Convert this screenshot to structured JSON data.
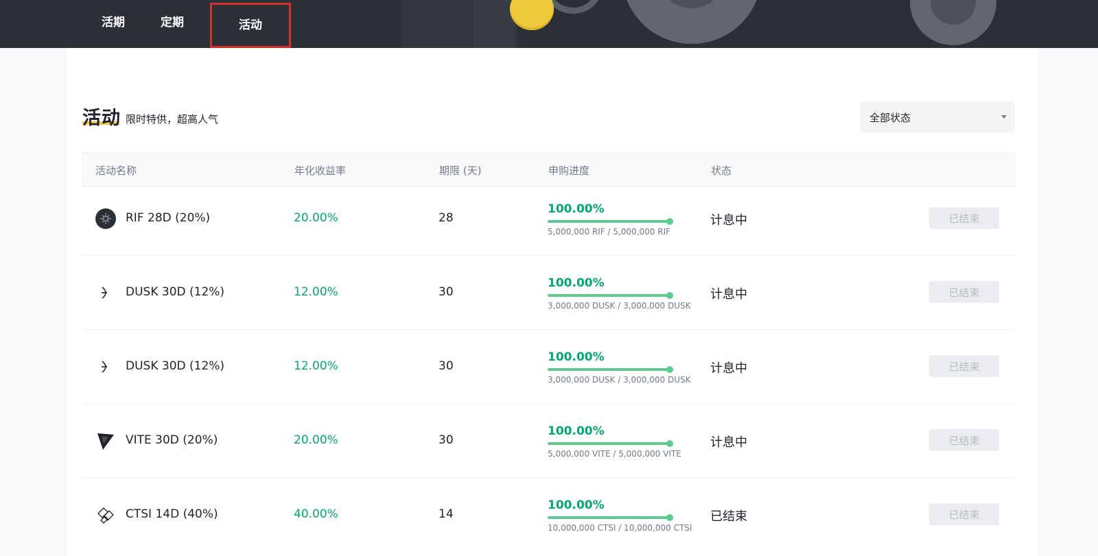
{
  "nav": {
    "tabs": [
      {
        "label": "活期"
      },
      {
        "label": "定期"
      },
      {
        "label": "活动"
      }
    ],
    "active_tab": "活动"
  },
  "section": {
    "title": "活动",
    "subtitle": "限时特供，超高人气"
  },
  "filter": {
    "selected": "全部状态"
  },
  "table": {
    "headers": {
      "name": "活动名称",
      "apy": "年化收益率",
      "term": "期限 (天)",
      "progress": "申购进度",
      "status": "状态"
    },
    "rows": [
      {
        "icon": "rif-icon",
        "name": "RIF 28D (20%)",
        "apy": "20.00%",
        "term": "28",
        "progress_pct": "100.00%",
        "progress_fraction": 1.0,
        "amount": "5,000,000 RIF / 5,000,000 RIF",
        "status": "计息中",
        "button": "已结束"
      },
      {
        "icon": "dusk-icon",
        "name": "DUSK 30D (12%)",
        "apy": "12.00%",
        "term": "30",
        "progress_pct": "100.00%",
        "progress_fraction": 1.0,
        "amount": "3,000,000 DUSK / 3,000,000 DUSK",
        "status": "计息中",
        "button": "已结束"
      },
      {
        "icon": "dusk-icon",
        "name": "DUSK 30D (12%)",
        "apy": "12.00%",
        "term": "30",
        "progress_pct": "100.00%",
        "progress_fraction": 1.0,
        "amount": "3,000,000 DUSK / 3,000,000 DUSK",
        "status": "计息中",
        "button": "已结束"
      },
      {
        "icon": "vite-icon",
        "name": "VITE 30D (20%)",
        "apy": "20.00%",
        "term": "30",
        "progress_pct": "100.00%",
        "progress_fraction": 1.0,
        "amount": "5,000,000 VITE / 5,000,000 VITE",
        "status": "计息中",
        "button": "已结束"
      },
      {
        "icon": "ctsi-icon",
        "name": "CTSI 14D (40%)",
        "apy": "40.00%",
        "term": "14",
        "progress_pct": "100.00%",
        "progress_fraction": 1.0,
        "amount": "10,000,000 CTSI / 10,000,000 CTSI",
        "status": "已结束",
        "button": "已结束"
      }
    ]
  },
  "colors": {
    "header_bg": "#2b2f36",
    "accent_green": "#03a66d",
    "progress_green": "#5fcb8e",
    "highlight_red": "#d0322b",
    "title_underline": "#f0b90b"
  }
}
